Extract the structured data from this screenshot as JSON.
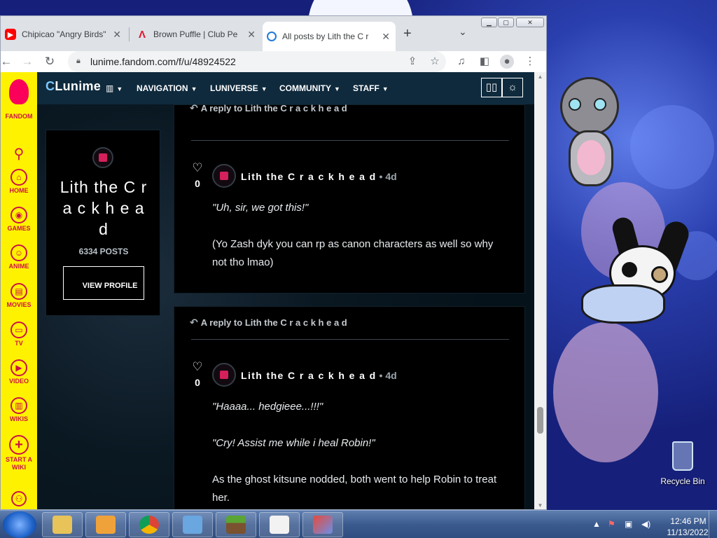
{
  "browser": {
    "tabs": [
      {
        "title": "Chipicao \"Angry Birds\"",
        "icon": "youtube-icon"
      },
      {
        "title": "Brown Puffle | Club Penguin",
        "icon": "fandom-a-icon"
      },
      {
        "title": "All posts by Lith the C r a c k h e a d",
        "icon": "lunime-icon"
      }
    ],
    "new_tab_symbol": "+",
    "url": "lunime.fandom.com/f/u/48924522"
  },
  "fandom_rail": {
    "items": [
      {
        "label": "FANDOM",
        "icon": "fandom-flame-icon"
      },
      {
        "label": "",
        "icon": "search-icon"
      },
      {
        "label": "HOME",
        "icon": "home-icon"
      },
      {
        "label": "GAMES",
        "icon": "games-icon"
      },
      {
        "label": "ANIME",
        "icon": "anime-icon"
      },
      {
        "label": "MOVIES",
        "icon": "movies-icon"
      },
      {
        "label": "TV",
        "icon": "tv-icon"
      },
      {
        "label": "VIDEO",
        "icon": "video-icon"
      },
      {
        "label": "WIKIS",
        "icon": "wikis-icon"
      },
      {
        "label": "START A WIKI",
        "icon": "plus-icon"
      },
      {
        "label": "",
        "icon": "account-icon"
      }
    ]
  },
  "wiki_header": {
    "logo_c": "C",
    "logo_rest": "Lunime",
    "nav": [
      "NAVIGATION",
      "LUNIVERSE",
      "COMMUNITY",
      "STAFF"
    ]
  },
  "profile": {
    "name": "Lith the C r a c k h e a d",
    "posts": "6334 POSTS",
    "view_profile": "VIEW PROFILE"
  },
  "posts": [
    {
      "reply_to": "A reply to Lith the C r a c k h e a d",
      "likes": "0",
      "author": "Lith the C r a c k h e a d",
      "age": "• 4d",
      "paragraphs": [
        {
          "text": "\"Uh, sir, we got this!\"",
          "italic": true
        },
        {
          "text": "(Yo Zash dyk you can rp as canon characters as well so why not tho lmao)",
          "italic": false
        }
      ]
    },
    {
      "reply_to": "A reply to Lith the C r a c k h e a d",
      "likes": "0",
      "author": "Lith the C r a c k h e a d",
      "age": "• 4d",
      "paragraphs": [
        {
          "text": "\"Haaaa... hedgieee...!!!\"",
          "italic": true
        },
        {
          "text": "\"Cry! Assist me while i heal Robin!\"",
          "italic": true
        },
        {
          "text": "As the ghost kitsune nodded, both went to help Robin to treat her.",
          "italic": false
        }
      ]
    }
  ],
  "desktop": {
    "recycle_bin": "Recycle Bin"
  },
  "taskbar": {
    "apps": [
      "file-explorer-icon",
      "media-player-icon",
      "chrome-icon",
      "control-panel-icon",
      "minecraft-icon",
      "java-icon",
      "rocket-app-icon"
    ],
    "time": "12:46 PM",
    "date": "11/13/2022"
  }
}
